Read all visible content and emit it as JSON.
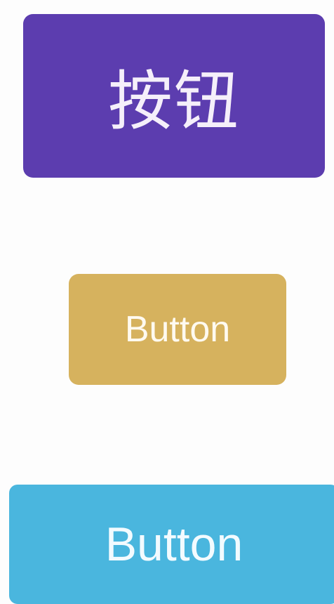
{
  "buttons": [
    {
      "label": "按钮",
      "background": "#5c3daf"
    },
    {
      "label": "Button",
      "background": "#d6b25e"
    },
    {
      "label": "Button",
      "background": "#4ab6de"
    }
  ],
  "colors": {
    "page_background": "#fdfdfd"
  }
}
